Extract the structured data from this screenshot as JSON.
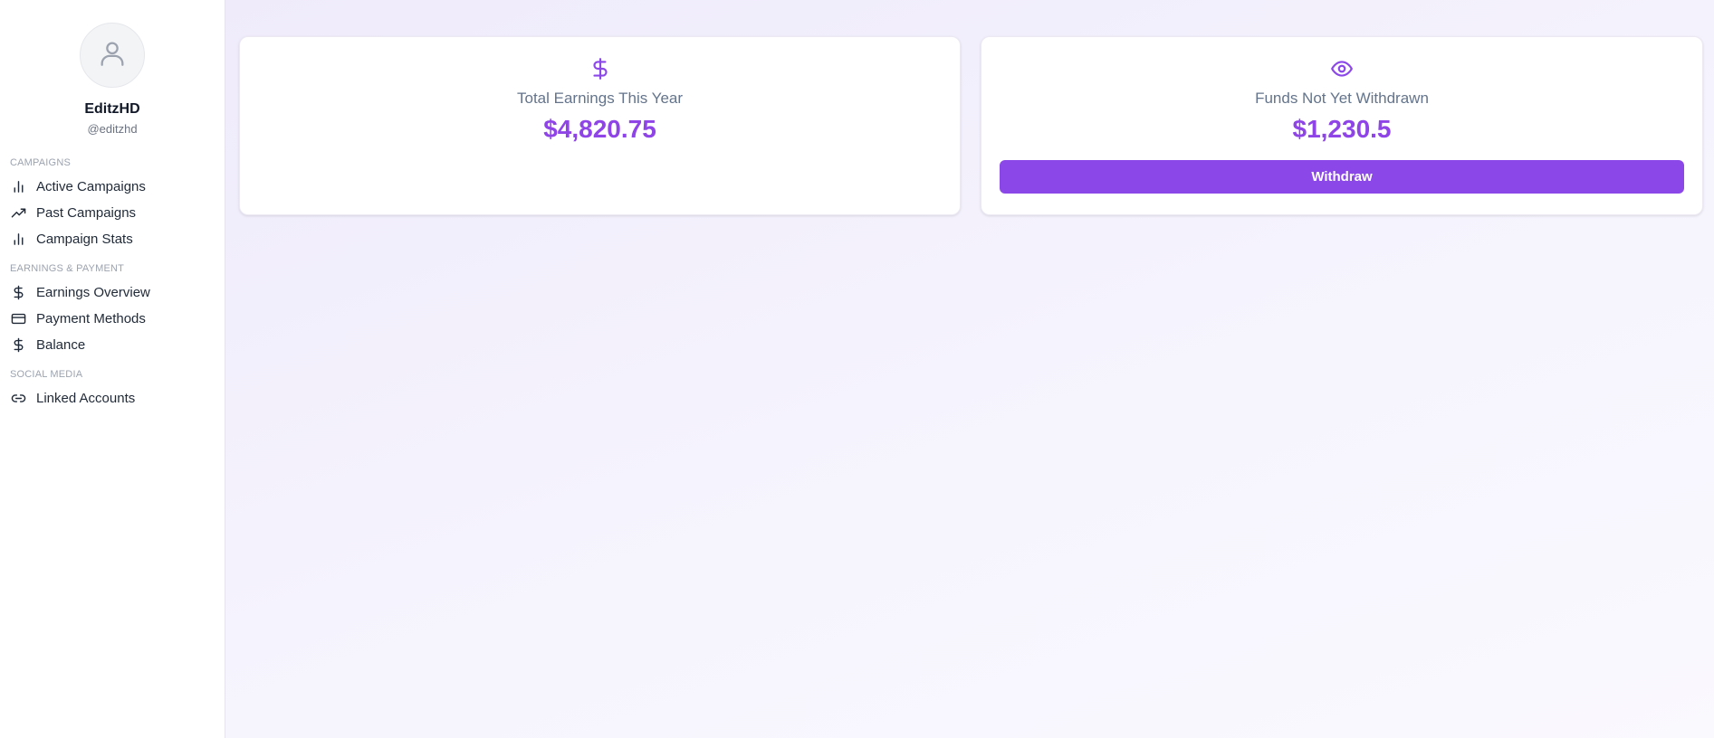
{
  "profile": {
    "name": "EditzHD",
    "handle": "@editzhd",
    "avatar_icon": "user-icon"
  },
  "sidebar": {
    "sections": [
      {
        "title": "CAMPAIGNS",
        "items": [
          {
            "label": "Active Campaigns",
            "icon": "bar-chart-icon"
          },
          {
            "label": "Past Campaigns",
            "icon": "trending-up-icon"
          },
          {
            "label": "Campaign Stats",
            "icon": "bar-chart-icon"
          }
        ]
      },
      {
        "title": "EARNINGS & PAYMENT",
        "items": [
          {
            "label": "Earnings Overview",
            "icon": "dollar-icon"
          },
          {
            "label": "Payment Methods",
            "icon": "credit-card-icon"
          },
          {
            "label": "Balance",
            "icon": "dollar-icon"
          }
        ]
      },
      {
        "title": "SOCIAL MEDIA",
        "items": [
          {
            "label": "Linked Accounts",
            "icon": "link-icon"
          }
        ]
      }
    ]
  },
  "cards": {
    "earnings": {
      "icon": "dollar-icon",
      "label": "Total Earnings This Year",
      "value": "$4,820.75"
    },
    "funds": {
      "icon": "eye-icon",
      "label": "Funds Not Yet Withdrawn",
      "value": "$1,230.5",
      "button_label": "Withdraw"
    }
  },
  "colors": {
    "accent": "#8b47e8",
    "value_text": "#8e44e6",
    "muted_text": "#64748b"
  }
}
